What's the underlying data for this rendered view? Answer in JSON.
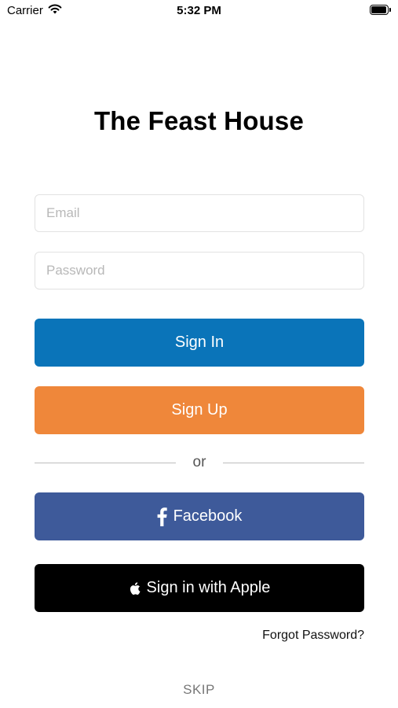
{
  "status_bar": {
    "carrier": "Carrier",
    "time": "5:32 PM",
    "wifi_icon": "wifi-icon",
    "battery_icon": "battery-icon"
  },
  "app": {
    "title": "The Feast House"
  },
  "form": {
    "email_placeholder": "Email",
    "email_value": "",
    "password_placeholder": "Password",
    "password_value": ""
  },
  "buttons": {
    "sign_in": "Sign In",
    "sign_up": "Sign Up",
    "divider_text": "or",
    "facebook": "Facebook",
    "apple": "Sign in with Apple",
    "forgot_password": "Forgot Password?",
    "skip": "SKIP"
  },
  "colors": {
    "sign_in": "#0a74b9",
    "sign_up": "#ef873a",
    "facebook": "#3e5a9a",
    "apple": "#000000"
  },
  "icons": {
    "facebook": "facebook-icon",
    "apple": "apple-icon"
  }
}
